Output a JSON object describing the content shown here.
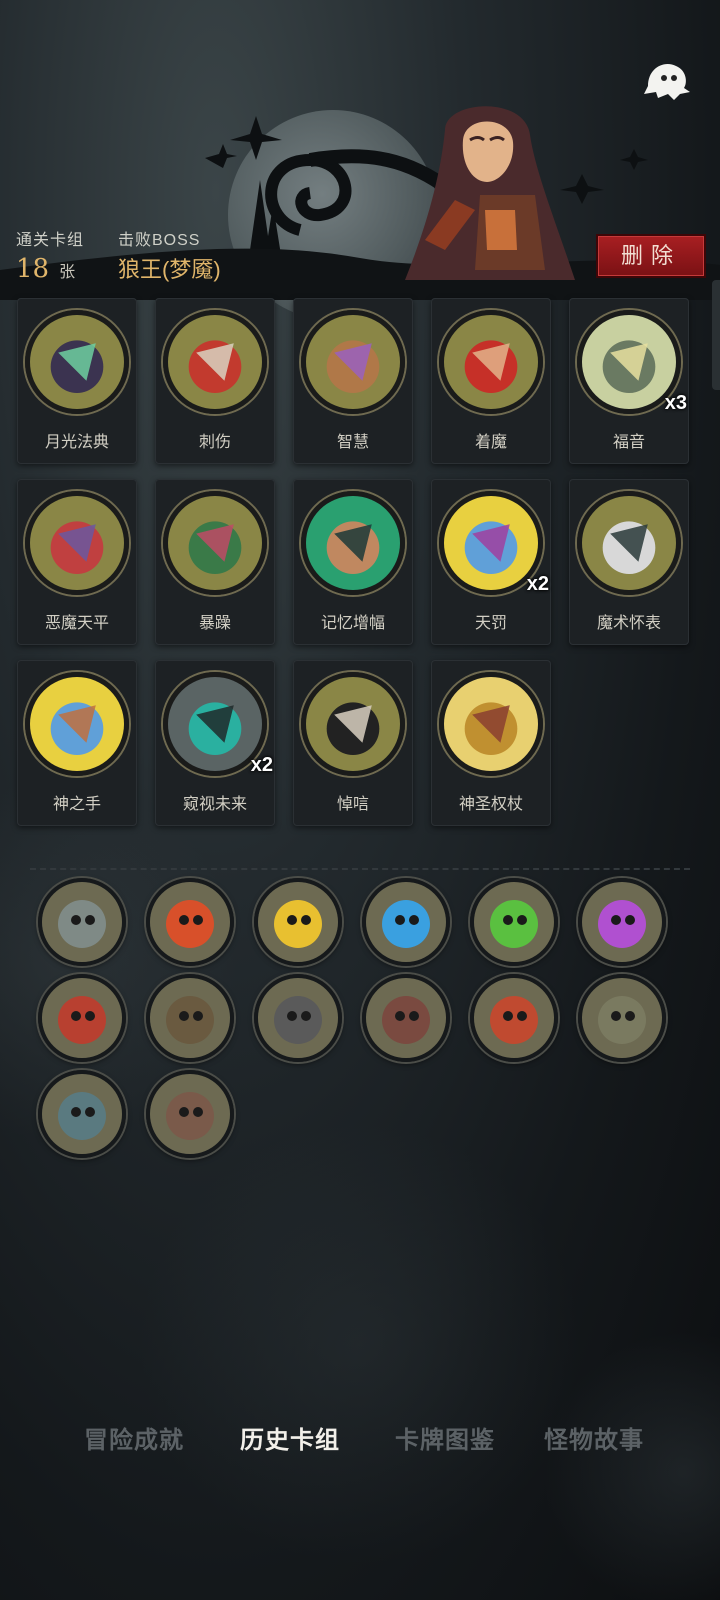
{
  "header": {
    "deck_label": "通关卡组",
    "deck_count": "18",
    "deck_unit": "张",
    "boss_label": "击败BOSS",
    "boss_name": "狼王(梦魇)",
    "delete_label": "删除"
  },
  "cards": [
    {
      "name": "月光法典",
      "count": "",
      "icon": "moonlight-tome-icon"
    },
    {
      "name": "刺伤",
      "count": "",
      "icon": "stab-dagger-icon"
    },
    {
      "name": "智慧",
      "count": "",
      "icon": "wisdom-scholar-icon"
    },
    {
      "name": "着魔",
      "count": "",
      "icon": "possessed-icon"
    },
    {
      "name": "福音",
      "count": "x3",
      "icon": "gospel-cross-icon"
    },
    {
      "name": "恶魔天平",
      "count": "",
      "icon": "demon-scale-icon"
    },
    {
      "name": "暴躁",
      "count": "",
      "icon": "rage-ogre-icon"
    },
    {
      "name": "记忆增幅",
      "count": "",
      "icon": "memory-brain-icon"
    },
    {
      "name": "天罚",
      "count": "x2",
      "icon": "divine-lightning-icon"
    },
    {
      "name": "魔术怀表",
      "count": "",
      "icon": "magic-pocket-watch-icon"
    },
    {
      "name": "神之手",
      "count": "",
      "icon": "hand-of-god-icon"
    },
    {
      "name": "窥视未来",
      "count": "x2",
      "icon": "future-sight-staff-icon"
    },
    {
      "name": "悼唁",
      "count": "",
      "icon": "mourning-nun-icon"
    },
    {
      "name": "神圣权杖",
      "count": "",
      "icon": "holy-scepter-icon"
    }
  ],
  "relics": [
    "crescent-moon-icon",
    "skull-red-flame-icon",
    "skull-yellow-flame-icon",
    "skull-blue-flame-icon",
    "skull-green-flame-icon",
    "skull-purple-flame-icon",
    "red-shield-icon",
    "bloody-blade-icon",
    "dagger-coins-icon",
    "vampire-icon",
    "hourglass-demon-icon",
    "preacher-icon",
    "card-hand-icon",
    "bleeding-arms-icon"
  ],
  "nav": {
    "items": [
      "冒险成就",
      "历史卡组",
      "卡牌图鉴",
      "怪物故事"
    ],
    "active": "历史卡组"
  },
  "colors": {
    "accent_gold": "#e0b56a",
    "delete_red": "#a81f22"
  }
}
